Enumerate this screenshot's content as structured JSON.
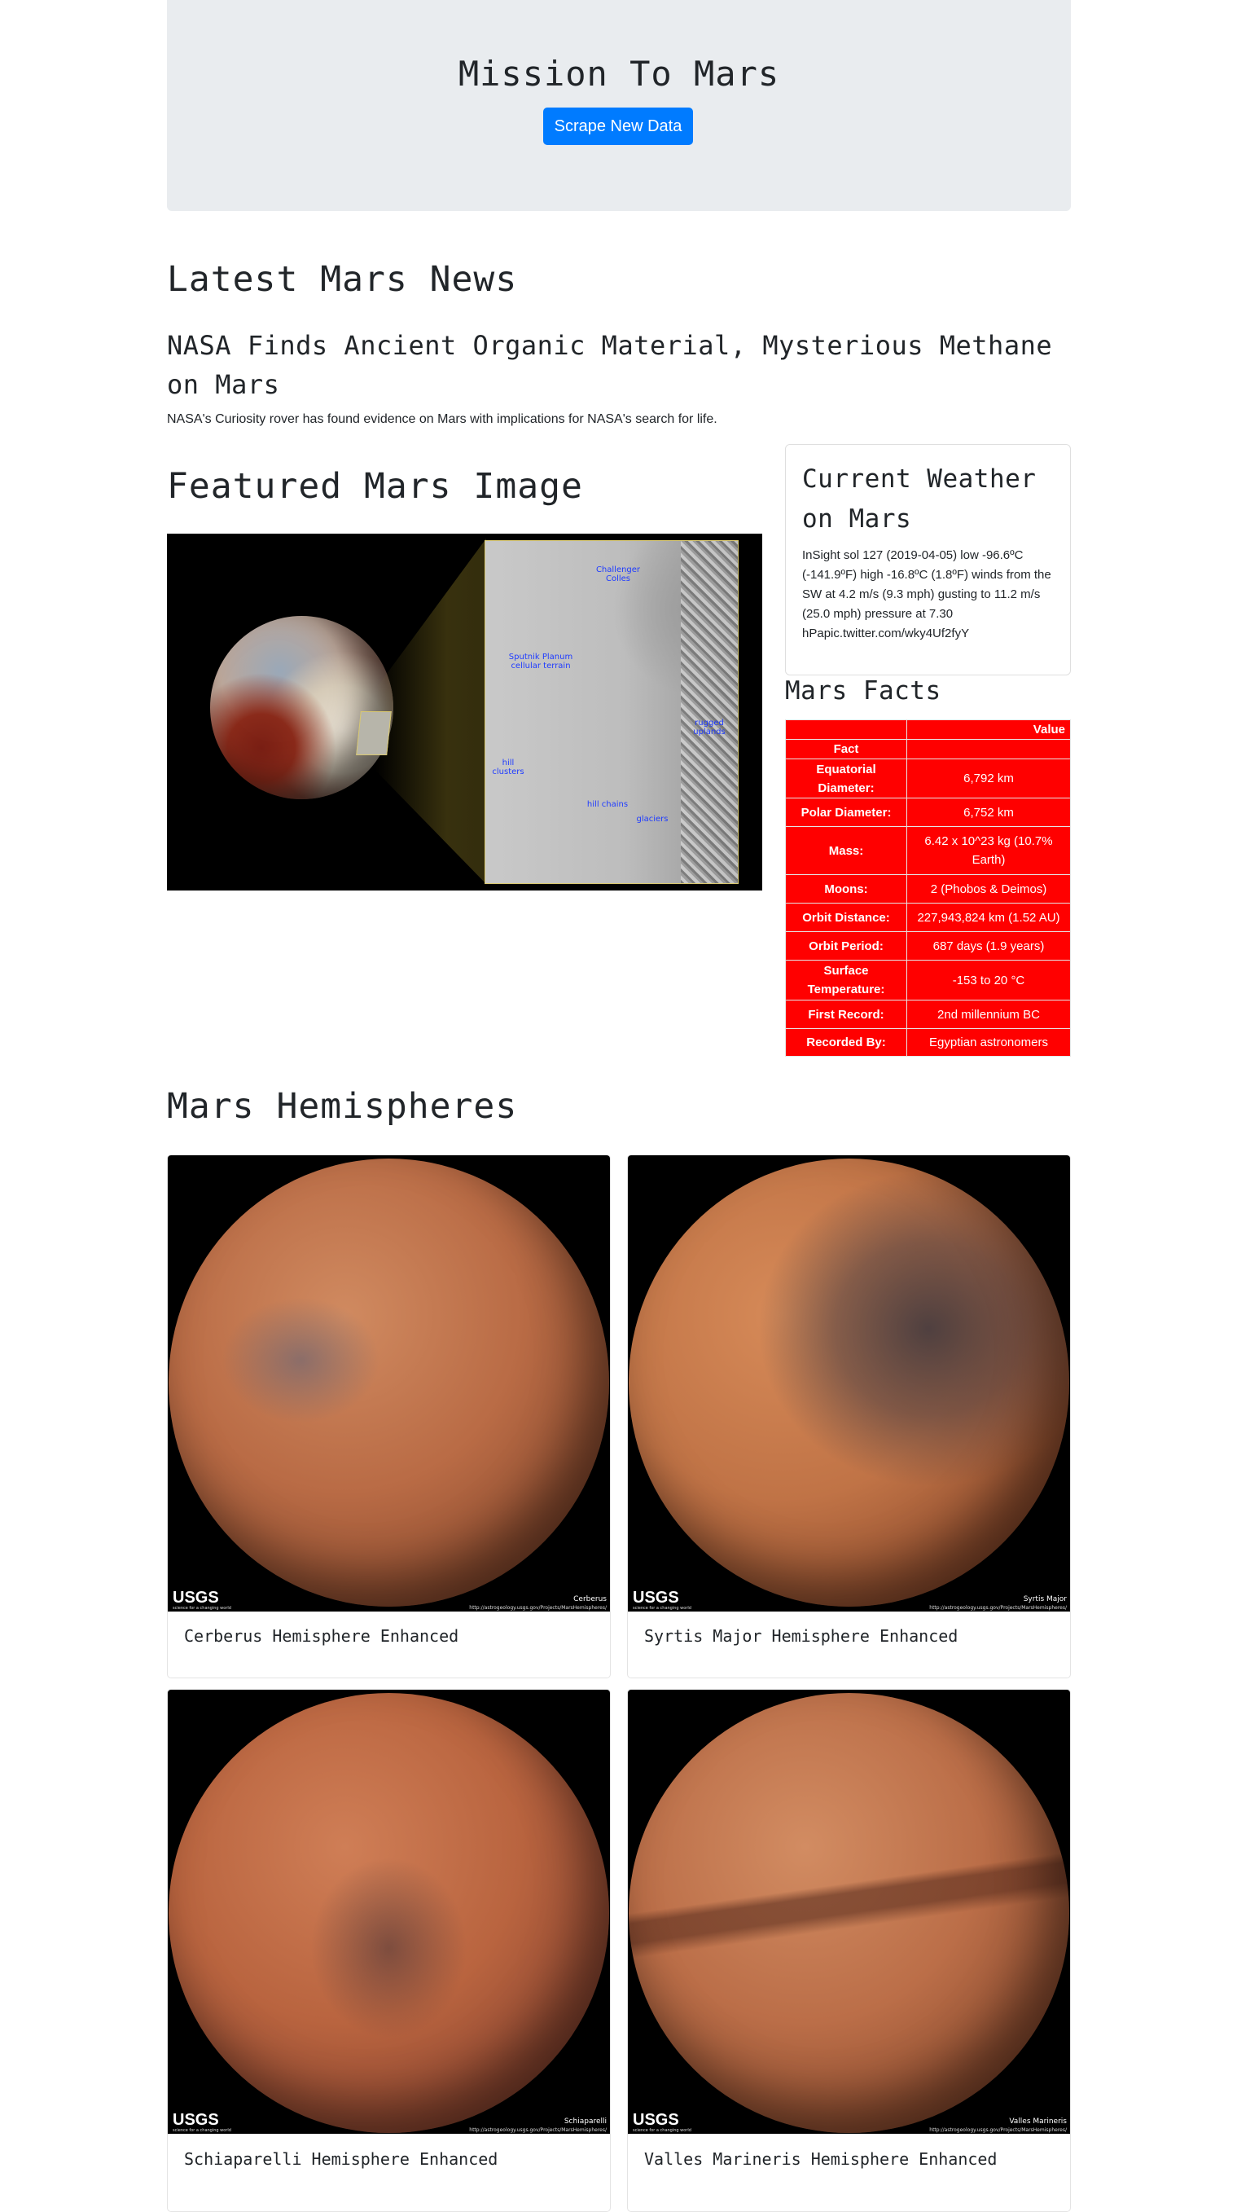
{
  "jumbotron": {
    "title": "Mission To Mars",
    "button_label": "Scrape New Data",
    "button_color": "#007bff"
  },
  "news": {
    "section_heading": "Latest Mars News",
    "title": "NASA Finds Ancient Organic Material, Mysterious Methane on Mars",
    "teaser": "NASA's Curiosity rover has found evidence on Mars with implications for NASA's search for life."
  },
  "featured": {
    "section_heading": "Featured Mars Image",
    "image_labels": [
      "Challenger Colles",
      "Sputnik Planum cellular terrain",
      "rugged uplands",
      "hill clusters",
      "hill chains",
      "glaciers"
    ]
  },
  "weather": {
    "title": "Current Weather on Mars",
    "text": "InSight sol 127 (2019-04-05) low -96.6ºC (-141.9ºF) high -16.8ºC (1.8ºF) winds from the SW at 4.2 m/s (9.3 mph) gusting to 11.2 m/s (25.0 mph) pressure at 7.30 hPapic.twitter.com/wky4Uf2fyY"
  },
  "facts": {
    "title": "Mars Facts",
    "header_value": "Value",
    "header_fact": "Fact",
    "table_color": "#ff0000",
    "rows": [
      {
        "fact": "Equatorial Diameter:",
        "value": "6,792 km"
      },
      {
        "fact": "Polar Diameter:",
        "value": "6,752 km"
      },
      {
        "fact": "Mass:",
        "value": "6.42 x 10^23 kg (10.7% Earth)"
      },
      {
        "fact": "Moons:",
        "value": "2 (Phobos & Deimos)"
      },
      {
        "fact": "Orbit Distance:",
        "value": "227,943,824 km (1.52 AU)"
      },
      {
        "fact": "Orbit Period:",
        "value": "687 days (1.9 years)"
      },
      {
        "fact": "Surface Temperature:",
        "value": "-153 to 20 °C"
      },
      {
        "fact": "First Record:",
        "value": "2nd millennium BC"
      },
      {
        "fact": "Recorded By:",
        "value": "Egyptian astronomers"
      }
    ]
  },
  "hemispheres": {
    "section_heading": "Mars Hemispheres",
    "usgs_logo": "USGS",
    "usgs_tagline": "science for a changing world",
    "image_url_text": "http://astrogeology.usgs.gov/Projects/MarsHemispheres/",
    "items": [
      {
        "title": "Cerberus Hemisphere Enhanced",
        "image_label": "Cerberus"
      },
      {
        "title": "Syrtis Major Hemisphere Enhanced",
        "image_label": "Syrtis Major"
      },
      {
        "title": "Schiaparelli Hemisphere Enhanced",
        "image_label": "Schiaparelli"
      },
      {
        "title": "Valles Marineris Hemisphere Enhanced",
        "image_label": "Valles Marineris"
      }
    ]
  }
}
